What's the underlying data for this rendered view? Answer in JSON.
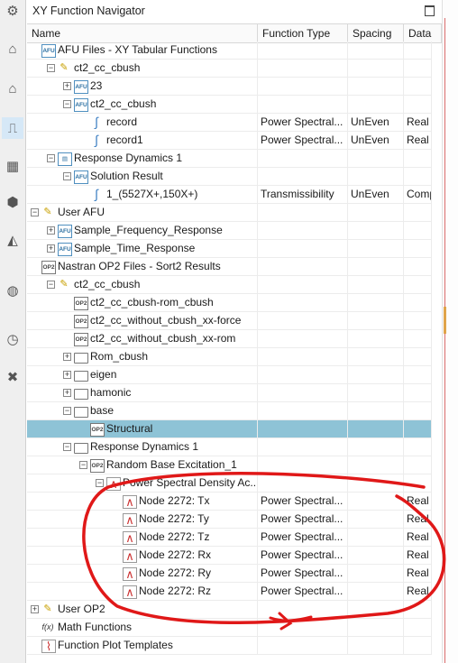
{
  "title": "XY Function Navigator",
  "columns": [
    "Name",
    "Function Type",
    "Spacing",
    "Data"
  ],
  "toolbar": [
    "gear-icon",
    "xy-tabular-icon",
    "xy-function-icon",
    "plot-icon",
    "color-grid-icon",
    "part-icon",
    "shell-icon",
    "globe-icon",
    "clock-icon",
    "tools-icon"
  ],
  "rows": [
    {
      "name": "AFU Files - XY Tabular Functions",
      "type": "",
      "spacing": "",
      "data": "",
      "icon": "afu-icon",
      "level": 0,
      "expander": "none"
    },
    {
      "name": "ct2_cc_cbush",
      "type": "",
      "spacing": "",
      "data": "",
      "icon": "afu-file-icon",
      "level": 1,
      "expander": "-"
    },
    {
      "name": "23",
      "type": "",
      "spacing": "",
      "data": "",
      "icon": "afu-icon",
      "level": 2,
      "expander": "+"
    },
    {
      "name": "ct2_cc_cbush",
      "type": "",
      "spacing": "",
      "data": "",
      "icon": "afu-link-icon",
      "level": 2,
      "expander": "-"
    },
    {
      "name": "record",
      "type": "Power Spectral...",
      "spacing": "UnEven",
      "data": "Real C",
      "icon": "curve-icon",
      "level": 3,
      "expander": "none"
    },
    {
      "name": "record1",
      "type": "Power Spectral...",
      "spacing": "UnEven",
      "data": "Real C",
      "icon": "curve-icon",
      "level": 3,
      "expander": "none"
    },
    {
      "name": "Response Dynamics 1",
      "type": "",
      "spacing": "",
      "data": "",
      "icon": "response-icon",
      "level": 1,
      "expander": "-"
    },
    {
      "name": "Solution Result",
      "type": "",
      "spacing": "",
      "data": "",
      "icon": "afu-icon",
      "level": 2,
      "expander": "-"
    },
    {
      "name": "1_(5527X+,150X+)",
      "type": "Transmissibility",
      "spacing": "UnEven",
      "data": "Comp",
      "icon": "curve-icon",
      "level": 3,
      "expander": "none"
    },
    {
      "name": "User AFU",
      "type": "",
      "spacing": "",
      "data": "",
      "icon": "afu-file-icon",
      "level": 0,
      "expander": "-"
    },
    {
      "name": "Sample_Frequency_Response",
      "type": "",
      "spacing": "",
      "data": "",
      "icon": "afu-icon",
      "level": 1,
      "expander": "+"
    },
    {
      "name": "Sample_Time_Response",
      "type": "",
      "spacing": "",
      "data": "",
      "icon": "afu-icon",
      "level": 1,
      "expander": "+"
    },
    {
      "name": "Nastran OP2 Files - Sort2 Results",
      "type": "",
      "spacing": "",
      "data": "",
      "icon": "op2-icon",
      "level": 0,
      "expander": "none"
    },
    {
      "name": "ct2_cc_cbush",
      "type": "",
      "spacing": "",
      "data": "",
      "icon": "op2-file-icon",
      "level": 1,
      "expander": "-"
    },
    {
      "name": "ct2_cc_cbush-rom_cbush",
      "type": "",
      "spacing": "",
      "data": "",
      "icon": "op2-icon",
      "level": 2,
      "expander": "none"
    },
    {
      "name": "ct2_cc_without_cbush_xx-force",
      "type": "",
      "spacing": "",
      "data": "",
      "icon": "op2-icon",
      "level": 2,
      "expander": "none"
    },
    {
      "name": "ct2_cc_without_cbush_xx-rom",
      "type": "",
      "spacing": "",
      "data": "",
      "icon": "op2-icon",
      "level": 2,
      "expander": "none"
    },
    {
      "name": "Rom_cbush",
      "type": "",
      "spacing": "",
      "data": "",
      "icon": "folder-icon",
      "level": 2,
      "expander": "+"
    },
    {
      "name": "eigen",
      "type": "",
      "spacing": "",
      "data": "",
      "icon": "folder-icon",
      "level": 2,
      "expander": "+"
    },
    {
      "name": "hamonic",
      "type": "",
      "spacing": "",
      "data": "",
      "icon": "folder-icon",
      "level": 2,
      "expander": "+"
    },
    {
      "name": "base",
      "type": "",
      "spacing": "",
      "data": "",
      "icon": "folder-icon",
      "level": 2,
      "expander": "-"
    },
    {
      "name": "Structural",
      "type": "",
      "spacing": "",
      "data": "",
      "icon": "op2-icon",
      "level": 3,
      "expander": "none",
      "selected": true
    },
    {
      "name": "Response Dynamics 1",
      "type": "",
      "spacing": "",
      "data": "",
      "icon": "folder-icon",
      "level": 2,
      "expander": "-"
    },
    {
      "name": "Random Base Excitation_1",
      "type": "",
      "spacing": "",
      "data": "",
      "icon": "op2-icon",
      "level": 3,
      "expander": "-"
    },
    {
      "name": "Power Spectral Density Ac...",
      "type": "",
      "spacing": "",
      "data": "",
      "icon": "psd-icon",
      "level": 4,
      "expander": "-"
    },
    {
      "name": "Node 2272: Tx",
      "type": "Power Spectral...",
      "spacing": "",
      "data": "Real C",
      "icon": "psd-icon",
      "level": 5,
      "expander": "none"
    },
    {
      "name": "Node 2272: Ty",
      "type": "Power Spectral...",
      "spacing": "",
      "data": "Real C",
      "icon": "psd-icon",
      "level": 5,
      "expander": "none"
    },
    {
      "name": "Node 2272: Tz",
      "type": "Power Spectral...",
      "spacing": "",
      "data": "Real C",
      "icon": "psd-icon",
      "level": 5,
      "expander": "none"
    },
    {
      "name": "Node 2272: Rx",
      "type": "Power Spectral...",
      "spacing": "",
      "data": "Real C",
      "icon": "psd-icon",
      "level": 5,
      "expander": "none"
    },
    {
      "name": "Node 2272: Ry",
      "type": "Power Spectral...",
      "spacing": "",
      "data": "Real C",
      "icon": "psd-icon",
      "level": 5,
      "expander": "none"
    },
    {
      "name": "Node 2272: Rz",
      "type": "Power Spectral...",
      "spacing": "",
      "data": "Real C",
      "icon": "psd-icon",
      "level": 5,
      "expander": "none"
    },
    {
      "name": "User OP2",
      "type": "",
      "spacing": "",
      "data": "",
      "icon": "op2-file-icon",
      "level": 0,
      "expander": "+"
    },
    {
      "name": "Math Functions",
      "type": "",
      "spacing": "",
      "data": "",
      "icon": "fx-icon",
      "level": 0,
      "expander": "none"
    },
    {
      "name": "Function Plot Templates",
      "type": "",
      "spacing": "",
      "data": "",
      "icon": "plot-template-icon",
      "level": 0,
      "expander": "none"
    }
  ],
  "colors": {
    "selection": "#8ec3d6",
    "annotation": "#e01818"
  }
}
